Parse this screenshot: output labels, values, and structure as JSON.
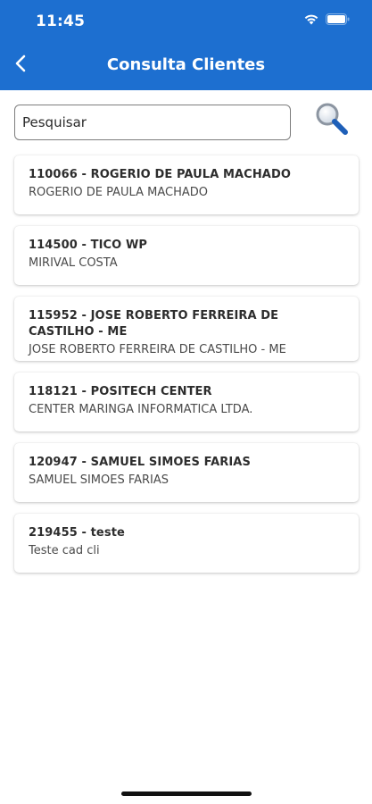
{
  "status_bar": {
    "time": "11:45",
    "icons": [
      "wifi-icon",
      "battery-icon"
    ]
  },
  "nav": {
    "title": "Consulta Clientes",
    "back_icon": "chevron-left-icon"
  },
  "search": {
    "placeholder": "Pesquisar",
    "value": "",
    "button_icon": "search-icon"
  },
  "clients": [
    {
      "title": "110066 - ROGERIO DE PAULA MACHADO",
      "subtitle": "ROGERIO DE PAULA MACHADO"
    },
    {
      "title": "114500 - TICO WP",
      "subtitle": "MIRIVAL COSTA"
    },
    {
      "title": "115952 - JOSE ROBERTO FERREIRA DE CASTILHO - ME",
      "subtitle": "JOSE ROBERTO FERREIRA DE CASTILHO - ME"
    },
    {
      "title": "118121 - POSITECH CENTER",
      "subtitle": "CENTER MARINGA INFORMATICA LTDA."
    },
    {
      "title": "120947 - SAMUEL SIMOES FARIAS",
      "subtitle": "SAMUEL SIMOES FARIAS"
    },
    {
      "title": "219455 - teste",
      "subtitle": "Teste cad cli"
    }
  ],
  "colors": {
    "header_bg": "#1d6fd0",
    "header_text": "#ffffff",
    "search_icon_lens": "#1e5fb8",
    "card_title": "#2d2d2d",
    "card_subtitle": "#4a4a4a"
  }
}
